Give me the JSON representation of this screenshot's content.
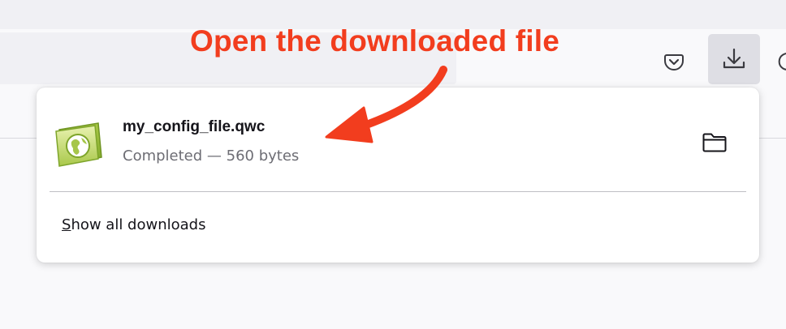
{
  "annotation": {
    "text": "Open the downloaded file",
    "color": "#f23d1e"
  },
  "toolbar": {
    "icons": [
      "pocket-icon",
      "download-icon",
      "account-icon"
    ]
  },
  "downloads_panel": {
    "item": {
      "icon": "qwc-file-icon",
      "file_name": "my_config_file.qwc",
      "status": "Completed — 560 bytes",
      "folder_icon": "folder-icon"
    },
    "show_all": {
      "accesskey": "S",
      "rest": "how all downloads"
    }
  },
  "colors": {
    "accent": "#f23d1e",
    "panel_bg": "#ffffff",
    "toolbar_bg": "#f9f9fb",
    "download_button_bg": "#dedee4"
  }
}
